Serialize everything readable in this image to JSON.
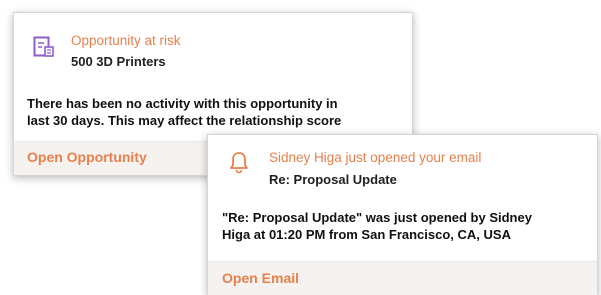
{
  "colors": {
    "accent": "#e8804b",
    "document_icon": "#8e5ec9",
    "footer_bg": "#f5f2f0",
    "text": "#111111"
  },
  "cards": [
    {
      "icon": "document-icon",
      "title": "Opportunity at risk",
      "subtitle": "500 3D Printers",
      "body_lines": [
        "There has been no activity with this opportunity in",
        "last 30 days. This may affect the relationship score"
      ],
      "action": "Open Opportunity"
    },
    {
      "icon": "bell-icon",
      "title": "Sidney Higa just opened your email",
      "subtitle": "Re: Proposal Update",
      "body_lines": [
        "\"Re: Proposal Update\" was just opened by Sidney",
        "Higa at 01:20 PM from San Francisco, CA, USA"
      ],
      "action": "Open Email"
    }
  ]
}
